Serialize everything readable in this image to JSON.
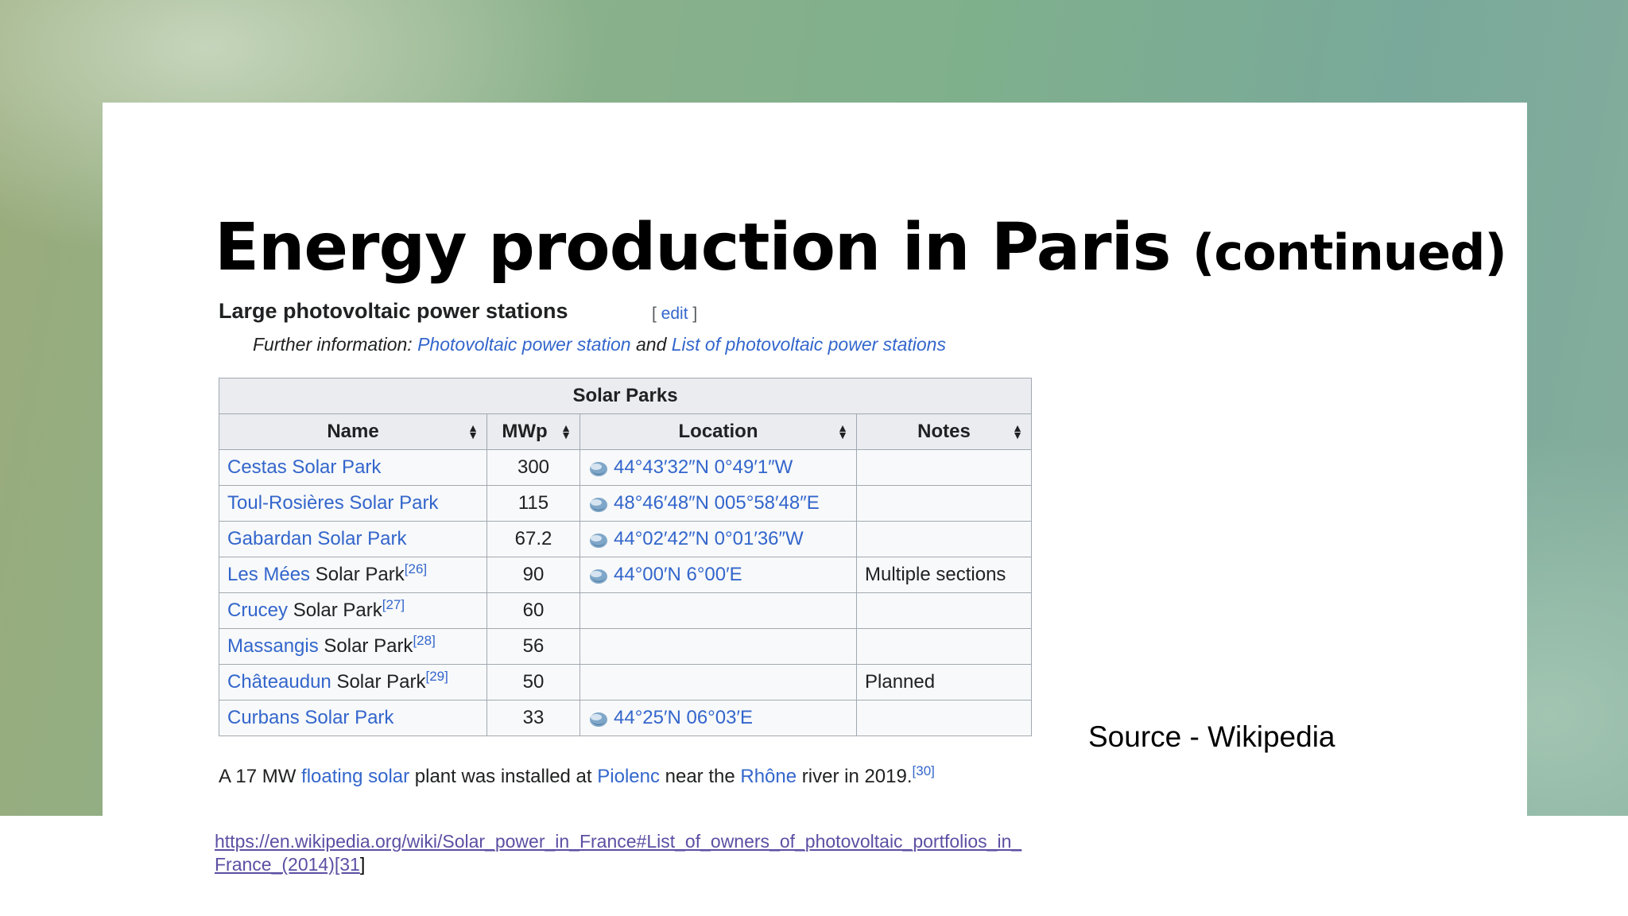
{
  "slide": {
    "title_main": "Energy production in Paris ",
    "title_sub": "(continued)",
    "source": "Source - Wikipedia",
    "url_text": "https://en.wikipedia.org/wiki/Solar_power_in_France#List_of_owners_of_photovoltaic_portfolios_in_France_(2014)[31",
    "url_tail": "]"
  },
  "wiki": {
    "heading": "Large photovoltaic power stations",
    "edit_open": "[ ",
    "edit_label": "edit",
    "edit_close": " ]",
    "further_prefix": "Further information: ",
    "further_link1": "Photovoltaic power station",
    "further_and": " and ",
    "further_link2": "List of photovoltaic power stations",
    "floating": {
      "t1": "A 17 MW ",
      "l1": "floating solar",
      "t2": " plant was installed at ",
      "l2": "Piolenc",
      "t3": " near the ",
      "l3": "Rhône",
      "t4": " river in 2019.",
      "ref": "[30]"
    }
  },
  "table": {
    "caption": "Solar Parks",
    "headers": [
      "Name",
      "MWp",
      "Location",
      "Notes"
    ],
    "rows": [
      {
        "link": "Cestas Solar Park",
        "rest": "",
        "ref": "",
        "mwp": "300",
        "location": "44°43′32″N 0°49′1″W",
        "notes": ""
      },
      {
        "link": "Toul-Rosières Solar Park",
        "rest": "",
        "ref": "",
        "mwp": "115",
        "location": "48°46′48″N 005°58′48″E",
        "notes": ""
      },
      {
        "link": "Gabardan Solar Park",
        "rest": "",
        "ref": "",
        "mwp": "67.2",
        "location": "44°02′42″N 0°01′36″W",
        "notes": ""
      },
      {
        "link": "Les Mées",
        "rest": " Solar Park",
        "ref": "[26]",
        "mwp": "90",
        "location": "44°00′N 6°00′E",
        "notes": "Multiple sections"
      },
      {
        "link": "Crucey",
        "rest": " Solar Park",
        "ref": "[27]",
        "mwp": "60",
        "location": "",
        "notes": ""
      },
      {
        "link": "Massangis",
        "rest": " Solar Park",
        "ref": "[28]",
        "mwp": "56",
        "location": "",
        "notes": ""
      },
      {
        "link": "Châteaudun",
        "rest": " Solar Park",
        "ref": "[29]",
        "mwp": "50",
        "location": "",
        "notes": "Planned"
      },
      {
        "link": "Curbans Solar Park",
        "rest": "",
        "ref": "",
        "mwp": "33",
        "location": "44°25′N 06°03′E",
        "notes": ""
      }
    ]
  },
  "icons": {
    "sort": "sort-icon",
    "globe": "globe-icon"
  }
}
